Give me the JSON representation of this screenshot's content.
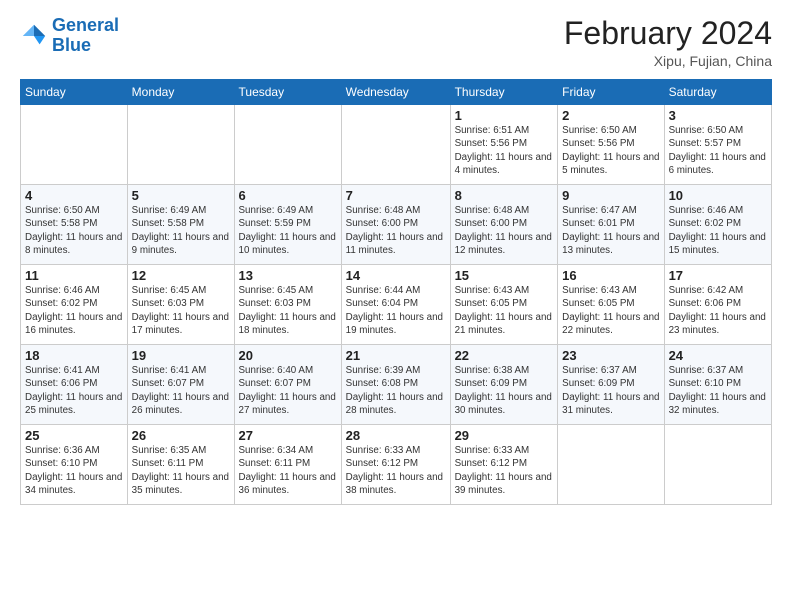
{
  "header": {
    "logo_general": "General",
    "logo_blue": "Blue",
    "month": "February 2024",
    "location": "Xipu, Fujian, China"
  },
  "weekdays": [
    "Sunday",
    "Monday",
    "Tuesday",
    "Wednesday",
    "Thursday",
    "Friday",
    "Saturday"
  ],
  "weeks": [
    [
      null,
      null,
      null,
      null,
      {
        "day": "1",
        "sunrise": "6:51 AM",
        "sunset": "5:56 PM",
        "daylight": "11 hours and 4 minutes."
      },
      {
        "day": "2",
        "sunrise": "6:50 AM",
        "sunset": "5:56 PM",
        "daylight": "11 hours and 5 minutes."
      },
      {
        "day": "3",
        "sunrise": "6:50 AM",
        "sunset": "5:57 PM",
        "daylight": "11 hours and 6 minutes."
      }
    ],
    [
      {
        "day": "4",
        "sunrise": "6:50 AM",
        "sunset": "5:58 PM",
        "daylight": "11 hours and 8 minutes."
      },
      {
        "day": "5",
        "sunrise": "6:49 AM",
        "sunset": "5:58 PM",
        "daylight": "11 hours and 9 minutes."
      },
      {
        "day": "6",
        "sunrise": "6:49 AM",
        "sunset": "5:59 PM",
        "daylight": "11 hours and 10 minutes."
      },
      {
        "day": "7",
        "sunrise": "6:48 AM",
        "sunset": "6:00 PM",
        "daylight": "11 hours and 11 minutes."
      },
      {
        "day": "8",
        "sunrise": "6:48 AM",
        "sunset": "6:00 PM",
        "daylight": "11 hours and 12 minutes."
      },
      {
        "day": "9",
        "sunrise": "6:47 AM",
        "sunset": "6:01 PM",
        "daylight": "11 hours and 13 minutes."
      },
      {
        "day": "10",
        "sunrise": "6:46 AM",
        "sunset": "6:02 PM",
        "daylight": "11 hours and 15 minutes."
      }
    ],
    [
      {
        "day": "11",
        "sunrise": "6:46 AM",
        "sunset": "6:02 PM",
        "daylight": "11 hours and 16 minutes."
      },
      {
        "day": "12",
        "sunrise": "6:45 AM",
        "sunset": "6:03 PM",
        "daylight": "11 hours and 17 minutes."
      },
      {
        "day": "13",
        "sunrise": "6:45 AM",
        "sunset": "6:03 PM",
        "daylight": "11 hours and 18 minutes."
      },
      {
        "day": "14",
        "sunrise": "6:44 AM",
        "sunset": "6:04 PM",
        "daylight": "11 hours and 19 minutes."
      },
      {
        "day": "15",
        "sunrise": "6:43 AM",
        "sunset": "6:05 PM",
        "daylight": "11 hours and 21 minutes."
      },
      {
        "day": "16",
        "sunrise": "6:43 AM",
        "sunset": "6:05 PM",
        "daylight": "11 hours and 22 minutes."
      },
      {
        "day": "17",
        "sunrise": "6:42 AM",
        "sunset": "6:06 PM",
        "daylight": "11 hours and 23 minutes."
      }
    ],
    [
      {
        "day": "18",
        "sunrise": "6:41 AM",
        "sunset": "6:06 PM",
        "daylight": "11 hours and 25 minutes."
      },
      {
        "day": "19",
        "sunrise": "6:41 AM",
        "sunset": "6:07 PM",
        "daylight": "11 hours and 26 minutes."
      },
      {
        "day": "20",
        "sunrise": "6:40 AM",
        "sunset": "6:07 PM",
        "daylight": "11 hours and 27 minutes."
      },
      {
        "day": "21",
        "sunrise": "6:39 AM",
        "sunset": "6:08 PM",
        "daylight": "11 hours and 28 minutes."
      },
      {
        "day": "22",
        "sunrise": "6:38 AM",
        "sunset": "6:09 PM",
        "daylight": "11 hours and 30 minutes."
      },
      {
        "day": "23",
        "sunrise": "6:37 AM",
        "sunset": "6:09 PM",
        "daylight": "11 hours and 31 minutes."
      },
      {
        "day": "24",
        "sunrise": "6:37 AM",
        "sunset": "6:10 PM",
        "daylight": "11 hours and 32 minutes."
      }
    ],
    [
      {
        "day": "25",
        "sunrise": "6:36 AM",
        "sunset": "6:10 PM",
        "daylight": "11 hours and 34 minutes."
      },
      {
        "day": "26",
        "sunrise": "6:35 AM",
        "sunset": "6:11 PM",
        "daylight": "11 hours and 35 minutes."
      },
      {
        "day": "27",
        "sunrise": "6:34 AM",
        "sunset": "6:11 PM",
        "daylight": "11 hours and 36 minutes."
      },
      {
        "day": "28",
        "sunrise": "6:33 AM",
        "sunset": "6:12 PM",
        "daylight": "11 hours and 38 minutes."
      },
      {
        "day": "29",
        "sunrise": "6:33 AM",
        "sunset": "6:12 PM",
        "daylight": "11 hours and 39 minutes."
      },
      null,
      null
    ]
  ]
}
